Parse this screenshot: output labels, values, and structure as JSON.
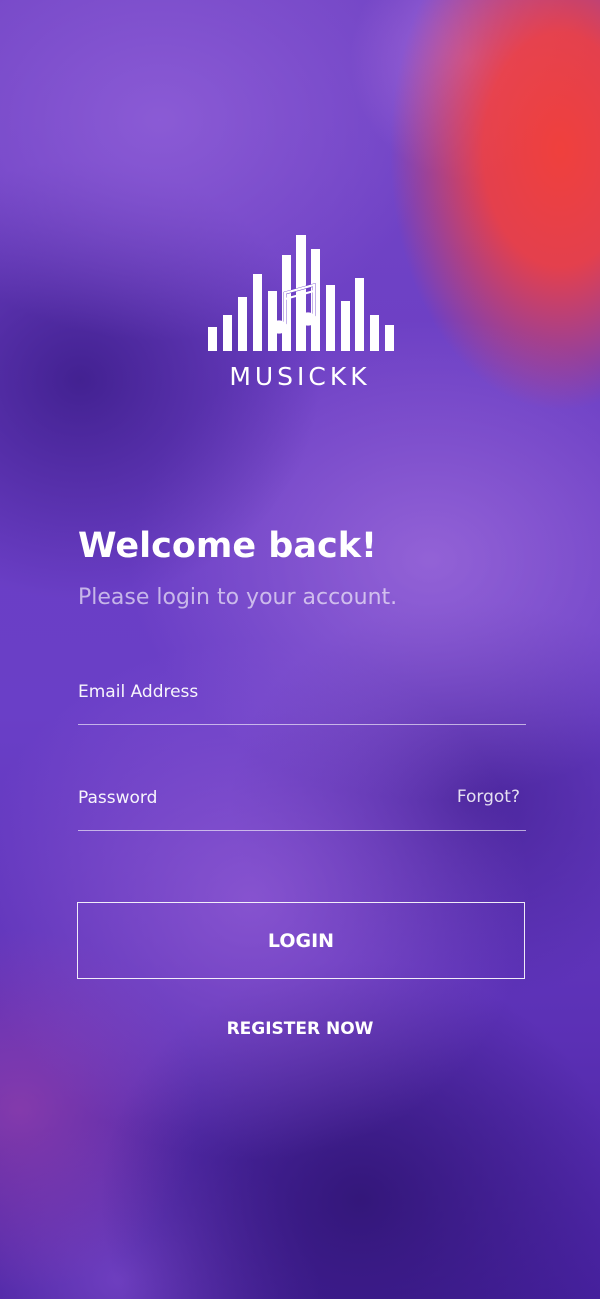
{
  "app": {
    "brand_name": "MUSICKK",
    "logo_icon": "equalizer-music-note-icon"
  },
  "login": {
    "headline": "Welcome back!",
    "subheadline": "Please login to your account.",
    "email_placeholder": "Email Address",
    "email_value": "",
    "password_placeholder": "Password",
    "password_value": "",
    "forgot_label": "Forgot?",
    "login_label": "LOGIN",
    "register_label": "REGISTER NOW"
  },
  "colors": {
    "background_primary": "#6a3fc7",
    "background_accent": "#f2403a",
    "text": "#ffffff"
  }
}
